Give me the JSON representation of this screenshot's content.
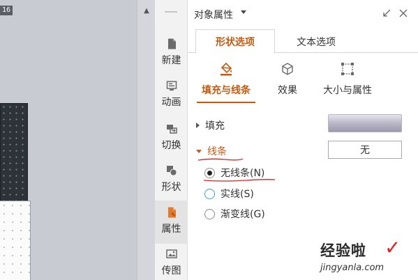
{
  "canvas": {
    "ruler_tag": "16"
  },
  "toolbar": {
    "items": [
      {
        "label": "新建",
        "icon": "document-icon"
      },
      {
        "label": "动画",
        "icon": "animation-icon"
      },
      {
        "label": "切换",
        "icon": "switch-icon"
      },
      {
        "label": "形状",
        "icon": "shape-icon"
      },
      {
        "label": "属性",
        "icon": "properties-icon"
      },
      {
        "label": "传图",
        "icon": "upload-image-icon"
      }
    ],
    "active_item": "属性"
  },
  "panel": {
    "title": "对象属性",
    "tabs": [
      {
        "label": "形状选项"
      },
      {
        "label": "文本选项"
      }
    ],
    "subtabs": [
      {
        "label": "填充与线条"
      },
      {
        "label": "效果"
      },
      {
        "label": "大小与属性"
      }
    ],
    "fill": {
      "label": "填充"
    },
    "line": {
      "label": "线条",
      "dropdown_value": "无",
      "options": [
        {
          "label": "无线条(N)",
          "checked": true
        },
        {
          "label": "实线(S)",
          "checked": false
        },
        {
          "label": "渐变线(G)",
          "checked": false
        }
      ]
    }
  },
  "watermark": {
    "text": "经验啦",
    "check": "✓",
    "url": "jingyanla.com"
  },
  "colors": {
    "accent": "#c55a11",
    "annotation_red": "#e02020",
    "radio_hover": "#3b9ae1"
  }
}
